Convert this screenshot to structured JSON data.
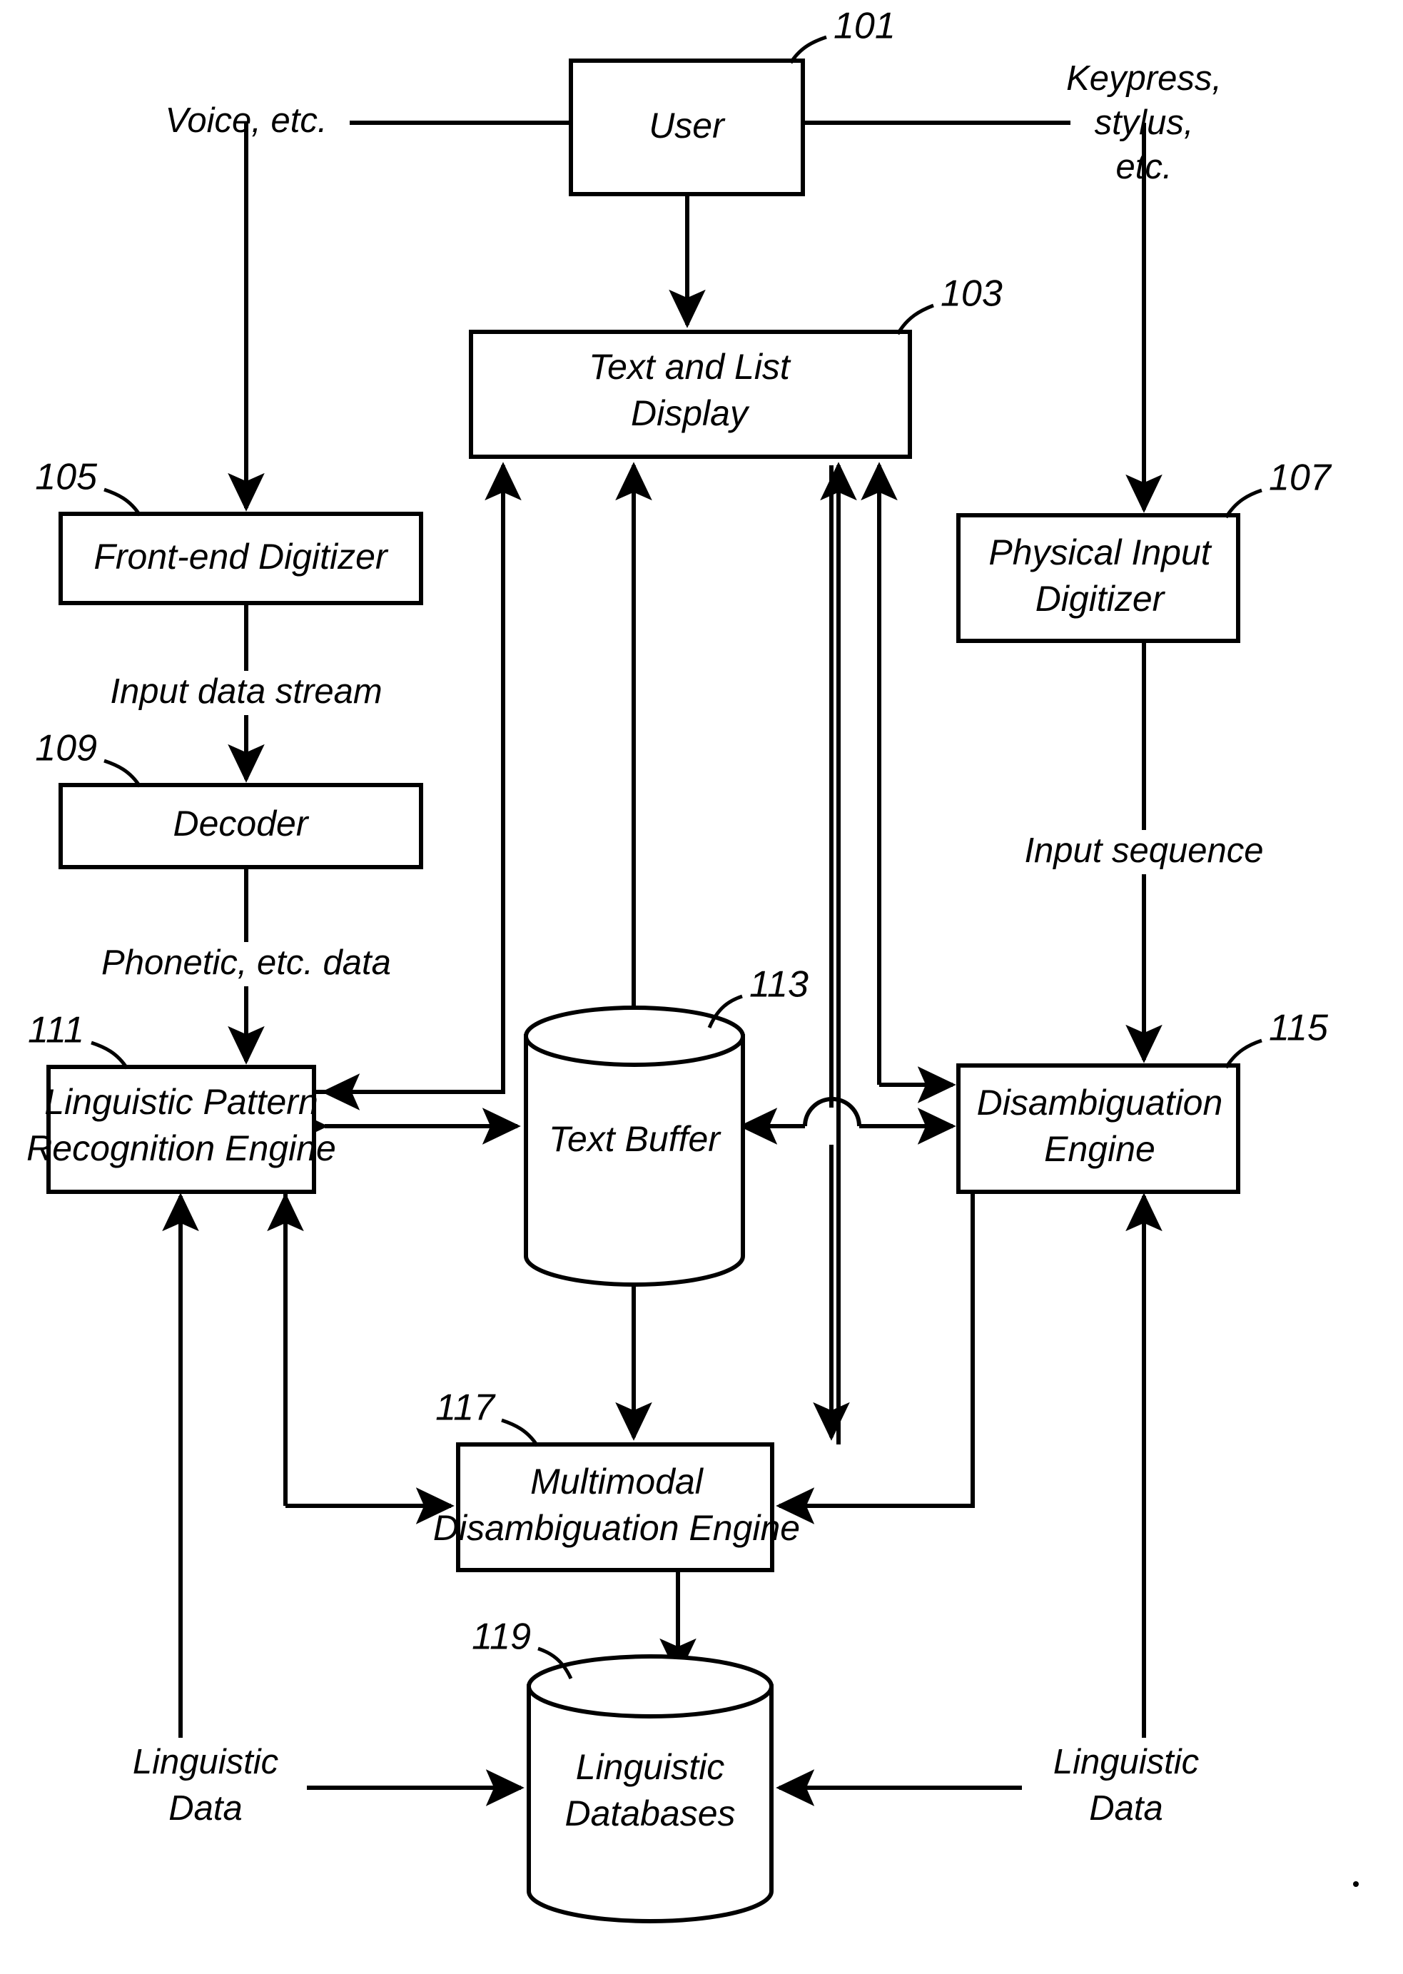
{
  "figure": {
    "type": "patent-block-diagram",
    "background": "#ffffff",
    "ink": "#000000"
  },
  "nodes": {
    "user": {
      "label": "User",
      "ref": "101"
    },
    "display": {
      "label_line1": "Text and List",
      "label_line2": "Display",
      "ref": "103"
    },
    "frontend": {
      "label": "Front-end Digitizer",
      "ref": "105"
    },
    "physical": {
      "label_line1": "Physical Input",
      "label_line2": "Digitizer",
      "ref": "107"
    },
    "decoder": {
      "label": "Decoder",
      "ref": "109"
    },
    "lpre": {
      "label_line1": "Linguistic Pattern",
      "label_line2": "Recognition Engine",
      "ref": "111"
    },
    "textbuffer": {
      "label": "Text Buffer",
      "ref": "113"
    },
    "disambig": {
      "label_line1": "Disambiguation",
      "label_line2": "Engine",
      "ref": "115"
    },
    "mde": {
      "label_line1": "Multimodal",
      "label_line2": "Disambiguation Engine",
      "ref": "117"
    },
    "lingdb": {
      "label_line1": "Linguistic",
      "label_line2": "Databases",
      "ref": "119"
    }
  },
  "edge_labels": {
    "voice": "Voice, etc.",
    "keypress_l1": "Keypress,",
    "keypress_l2": "stylus,",
    "keypress_l3": "etc.",
    "input_data_stream": "Input data stream",
    "phonetic_data": "Phonetic, etc. data",
    "input_sequence": "Input sequence",
    "ling_data_left_l1": "Linguistic",
    "ling_data_left_l2": "Data",
    "ling_data_right_l1": "Linguistic",
    "ling_data_right_l2": "Data"
  }
}
